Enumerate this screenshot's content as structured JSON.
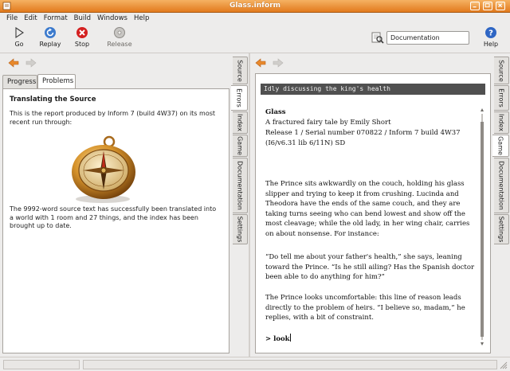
{
  "window": {
    "title": "Glass.inform"
  },
  "menu": [
    "File",
    "Edit",
    "Format",
    "Build",
    "Windows",
    "Help"
  ],
  "toolbar": {
    "go": "Go",
    "replay": "Replay",
    "stop": "Stop",
    "release": "Release",
    "search_value": "Documentation",
    "help": "Help"
  },
  "left_panel": {
    "tabs": [
      "Progress",
      "Problems"
    ],
    "active_tab": "Problems",
    "heading": "Translating the Source",
    "para1": [
      "This is the report produced by Inform 7 (build 4W37) on its most",
      "recent run through:"
    ],
    "para2": [
      "The 9992-word source text has successfully been translated into",
      "a world with 1 room and 27 things, and the index has been",
      "brought up to date."
    ]
  },
  "side_tabs_left": [
    "Source",
    "Errors",
    "Index",
    "Game",
    "Documentation",
    "Settings"
  ],
  "side_tabs_right": [
    "Source",
    "Errors",
    "Index",
    "Game",
    "Documentation",
    "Settings"
  ],
  "game": {
    "status_line": "Idly discussing the king's health",
    "title": "Glass",
    "subtitle": "A fractured fairy tale by Emily Short",
    "release": "Release 1 / Serial number 070822 / Inform 7 build 4W37",
    "lib": "(I6/v6.31 lib 6/11N) SD",
    "p1": [
      "The Prince sits awkwardly on the couch, holding his glass",
      "slipper and trying to keep it from crushing. Lucinda and",
      "Theodora have the ends of the same couch, and they are",
      "taking turns seeing who can bend lowest and show off the",
      "most cleavage; while the old lady, in her wing chair, carries",
      "on about nonsense. For instance:"
    ],
    "p2": [
      "“Do tell me about your father's health,” she says, leaning",
      "toward the Prince. “Is he still ailing? Has the Spanish doctor",
      "been able to do anything for him?”"
    ],
    "p3": [
      "The Prince looks uncomfortable: this line of reason leads",
      "directly to the problem of heirs. “I believe so, madam,” he",
      "replies, with a bit of constraint."
    ],
    "prompt": "> ",
    "command": "look"
  },
  "colors": {
    "titlebar": "#e8892c",
    "status_line_bg": "#505050",
    "back_arrow": "#e8892c"
  }
}
